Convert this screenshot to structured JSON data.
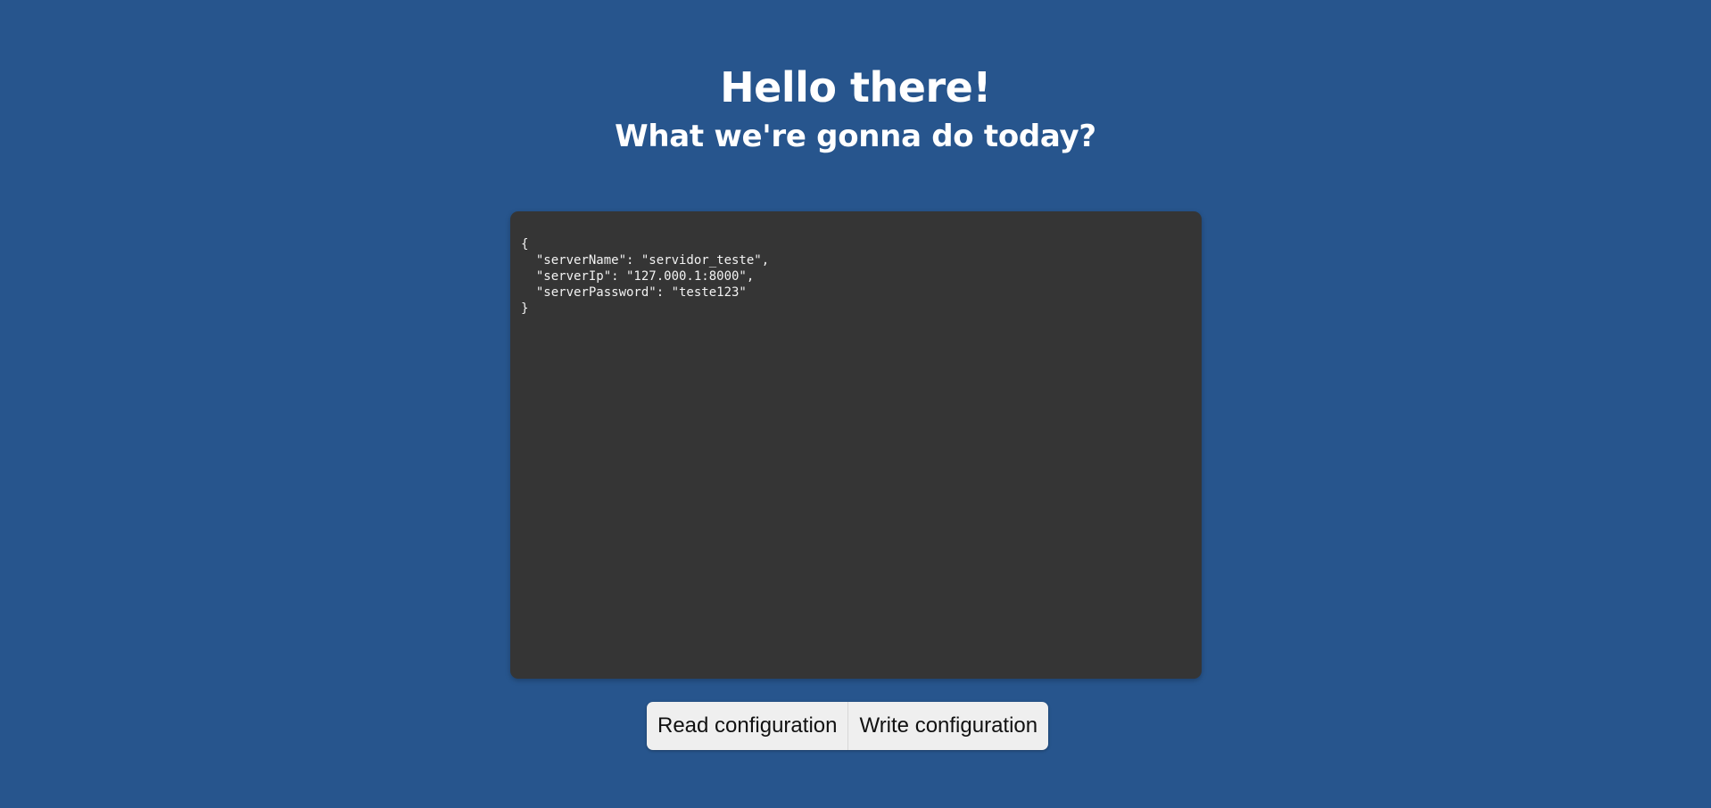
{
  "header": {
    "title": "Hello there!",
    "subtitle": "What we're gonna do today?"
  },
  "editor": {
    "content": "{\n  \"serverName\": \"servidor_teste\",\n  \"serverIp\": \"127.000.1:8000\",\n  \"serverPassword\": \"teste123\"\n}"
  },
  "actions": {
    "read_label": "Read configuration",
    "write_label": "Write configuration"
  },
  "colors": {
    "background": "#27558d",
    "editor_background": "#353535",
    "button_background": "#efefef"
  }
}
